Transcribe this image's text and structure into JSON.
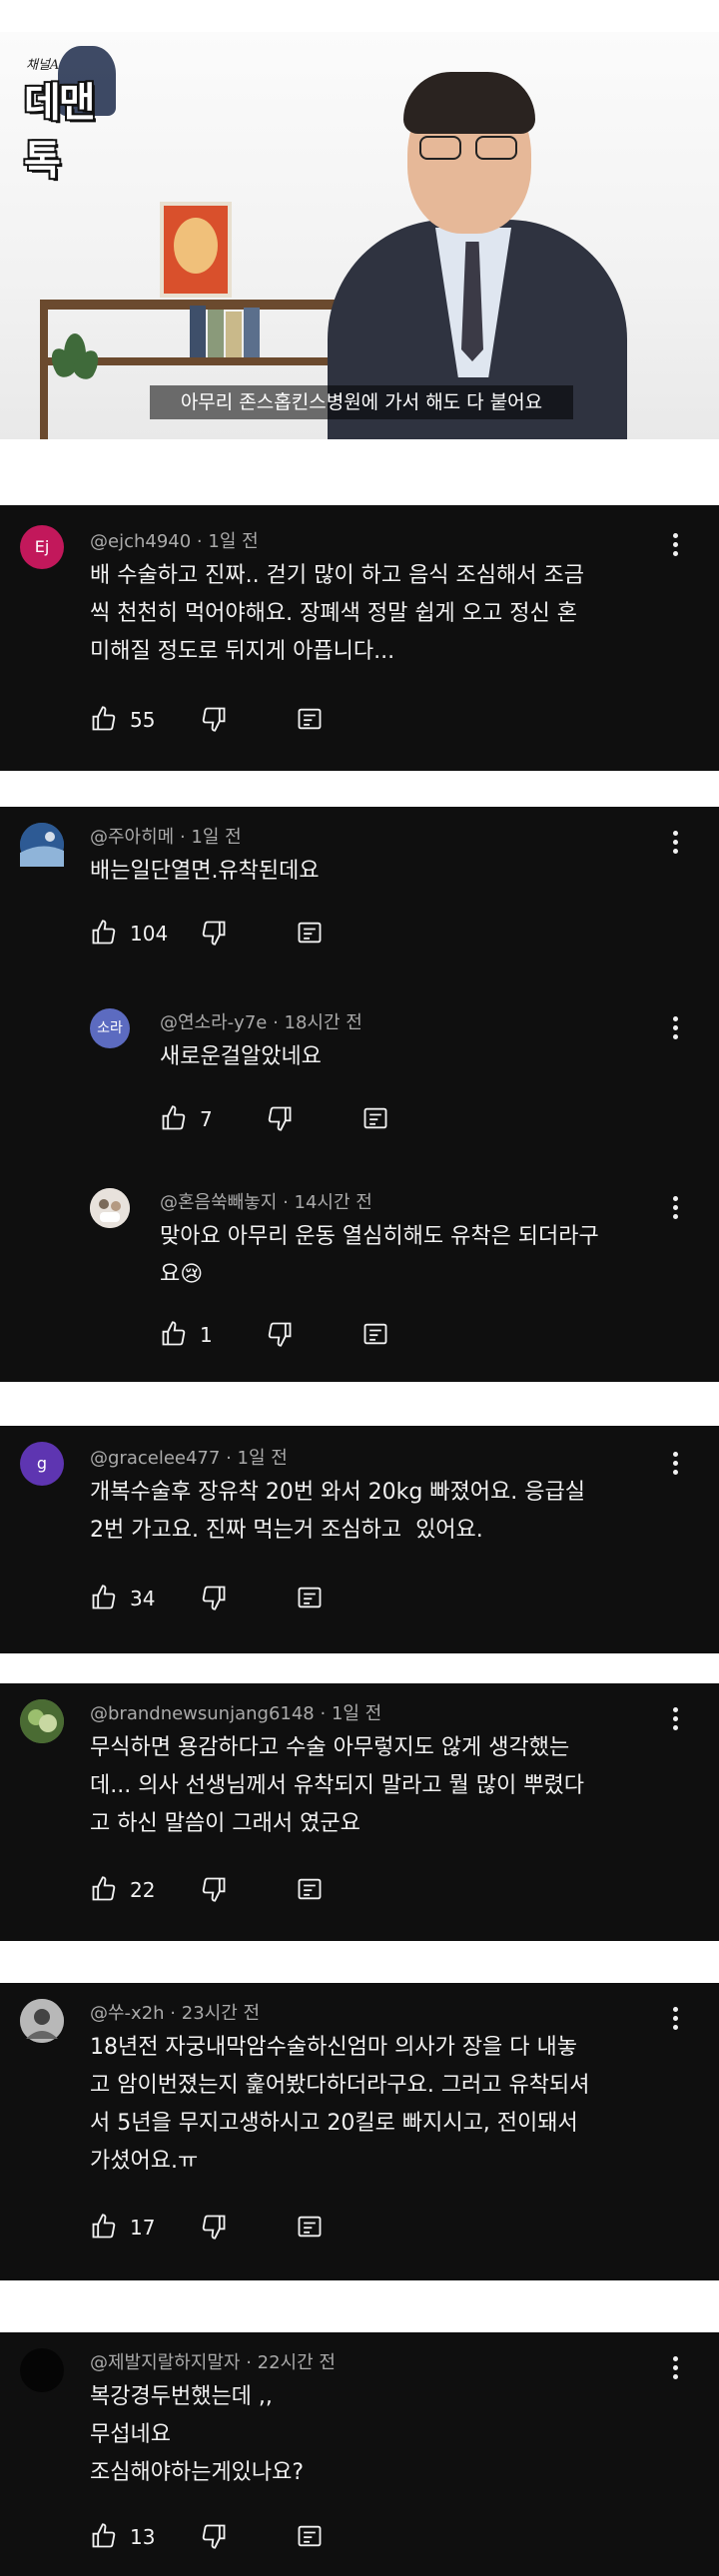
{
  "video": {
    "logo_sub": "채널A",
    "logo_main": "데맨톡",
    "caption": "아무리 존스홉킨스병원에 가서 해도 다 붙어요"
  },
  "comments": [
    {
      "author": "@ejch4940",
      "time": "1일 전",
      "avatar_text": "Ej",
      "avatar_color": "#c2185b",
      "lines": [
        "배 수술하고 진짜.. 걷기 많이 하고 음식 조심해서 조금",
        "씩 천천히 먹어야해요. 장폐색 정말 쉽게 오고 정신 혼",
        "미해질 정도로 뒤지게 아픕니다..."
      ],
      "likes": "55"
    },
    {
      "author": "@주아히메",
      "time": "1일 전",
      "avatar_text": "",
      "avatar_color": "#3b6fb0",
      "lines": [
        "배는일단열면.유착된데요"
      ],
      "likes": "104"
    },
    {
      "author": "@연소라-y7e",
      "time": "18시간 전",
      "avatar_text": "소라",
      "avatar_color": "#5c6bc0",
      "lines": [
        "새로운걸알았네요"
      ],
      "likes": "7"
    },
    {
      "author": "@혼음쑥빼놓지",
      "time": "14시간 전",
      "avatar_text": "",
      "avatar_color": "#d8d0c8",
      "lines": [
        "맞아요 아무리 운동 열심히해도 유착은 되더라구",
        "요😢"
      ],
      "likes": "1"
    },
    {
      "author": "@gracelee477",
      "time": "1일 전",
      "avatar_text": "g",
      "avatar_color": "#5e35b1",
      "lines": [
        "개복수술후 장유착 20번 와서 20kg 빠졌어요. 응급실",
        "2번 가고요. 진짜 먹는거 조심하고  있어요."
      ],
      "likes": "34"
    },
    {
      "author": "@brandnewsunjang6148",
      "time": "1일 전",
      "avatar_text": "",
      "avatar_color": "#6f8f4e",
      "lines": [
        "무식하면 용감하다고 수술 아무렇지도 않게 생각했는",
        "데... 의사 선생님께서 유착되지 말라고 뭘 많이 뿌렸다",
        "고 하신 말씀이 그래서 였군요"
      ],
      "likes": "22"
    },
    {
      "author": "@쑤-x2h",
      "time": "23시간 전",
      "avatar_text": "",
      "avatar_color": "#9a9a9a",
      "lines": [
        "18년전 자궁내막암수술하신엄마 의사가 장을 다 내놓",
        "고 암이번졌는지 훑어봤다하더라구요. 그러고 유착되셔",
        "서 5년을 무지고생하시고 20킬로 빠지시고, 전이돼서",
        "가셨어요.ㅠ"
      ],
      "likes": "17"
    },
    {
      "author": "@제발지랄하지말자",
      "time": "22시간 전",
      "avatar_text": "",
      "avatar_color": "#050505",
      "lines": [
        "복강경두번했는데 ,,",
        "무섭네요",
        "조심해야하는게있나요?"
      ],
      "likes": "13"
    }
  ]
}
